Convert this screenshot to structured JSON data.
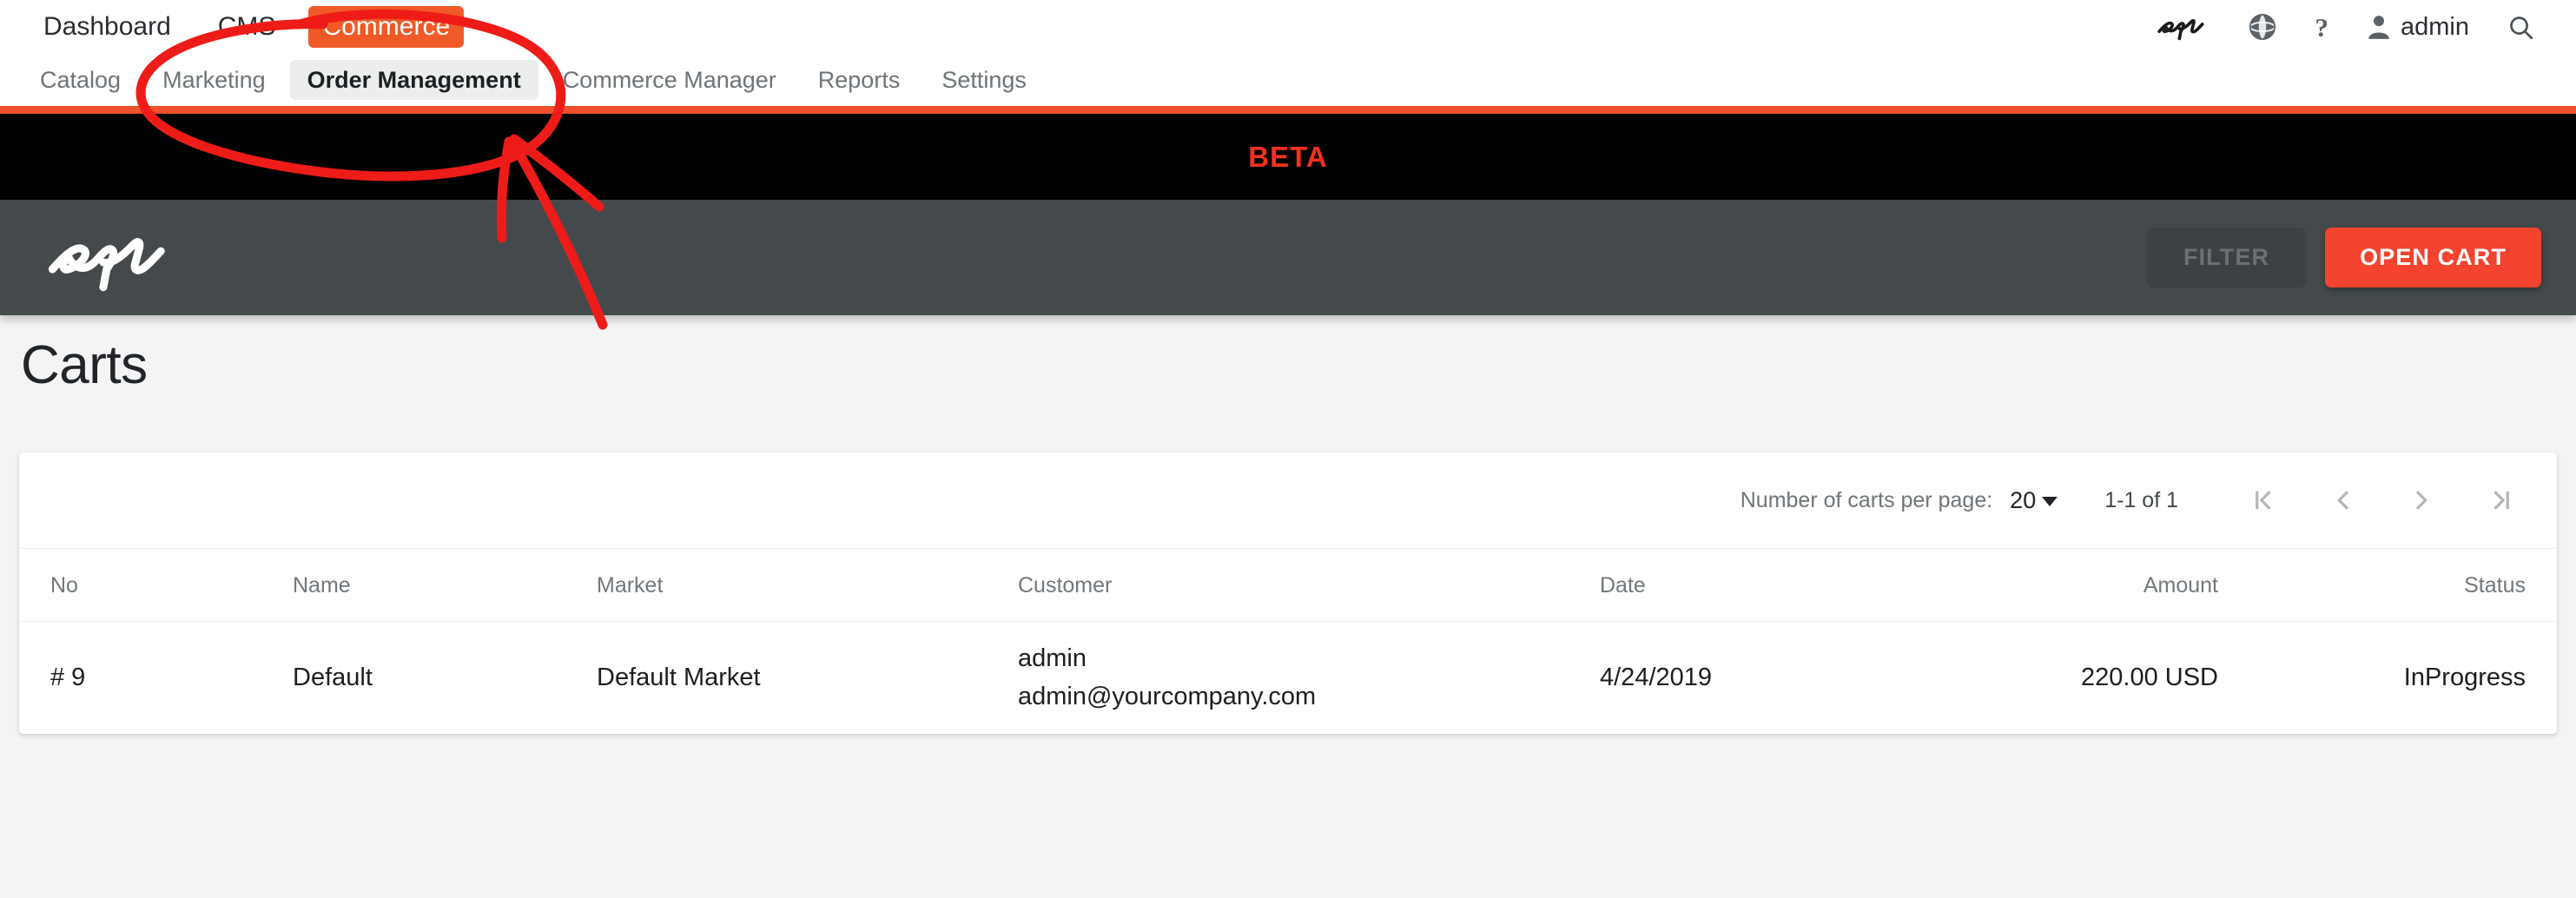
{
  "topnav": {
    "items": [
      {
        "label": "Dashboard",
        "active": false
      },
      {
        "label": "CMS",
        "active": false
      },
      {
        "label": "Commerce",
        "active": true
      }
    ],
    "logo_icon": "epi-logo-icon",
    "globe_icon": "globe-icon",
    "help_icon": "help-question-icon",
    "help_label": "?",
    "user_icon": "user-avatar-icon",
    "user_label": "admin",
    "search_icon": "search-icon"
  },
  "subnav": {
    "items": [
      {
        "label": "Catalog",
        "selected": false
      },
      {
        "label": "Marketing",
        "selected": false
      },
      {
        "label": "Order Management",
        "selected": true
      },
      {
        "label": "Commerce Manager",
        "selected": false
      },
      {
        "label": "Reports",
        "selected": false
      },
      {
        "label": "Settings",
        "selected": false
      }
    ]
  },
  "beta_bar": {
    "label": "BETA"
  },
  "apptoolbar": {
    "logo_icon": "epi-logo-icon",
    "filter_label": "FILTER",
    "open_cart_label": "OPEN CART"
  },
  "page": {
    "title": "Carts"
  },
  "pagination": {
    "per_page_label": "Number of carts per page:",
    "per_page_value": "20",
    "range_label": "1-1 of 1",
    "first_icon": "first-page-icon",
    "prev_icon": "previous-page-icon",
    "next_icon": "next-page-icon",
    "last_icon": "last-page-icon"
  },
  "table": {
    "columns": [
      "No",
      "Name",
      "Market",
      "Customer",
      "Date",
      "Amount",
      "Status"
    ],
    "rows": [
      {
        "no": "# 9",
        "name": "Default",
        "market": "Default Market",
        "customer_name": "admin",
        "customer_email": "admin@yourcompany.com",
        "date": "4/24/2019",
        "amount": "220.00 USD",
        "status": "InProgress"
      }
    ]
  },
  "annotation": {
    "type": "hand-drawn-circle-and-arrow",
    "color": "#ee1c18",
    "target": "Order Management"
  },
  "colors": {
    "accent_orange": "#f05a28",
    "accent_red": "#f4432e",
    "beta_red": "#f4301f",
    "toolbar_dark": "#44494c",
    "beta_bar_black": "#000000",
    "page_background": "#f4f4f4",
    "annotation_red": "#ee1c18"
  }
}
